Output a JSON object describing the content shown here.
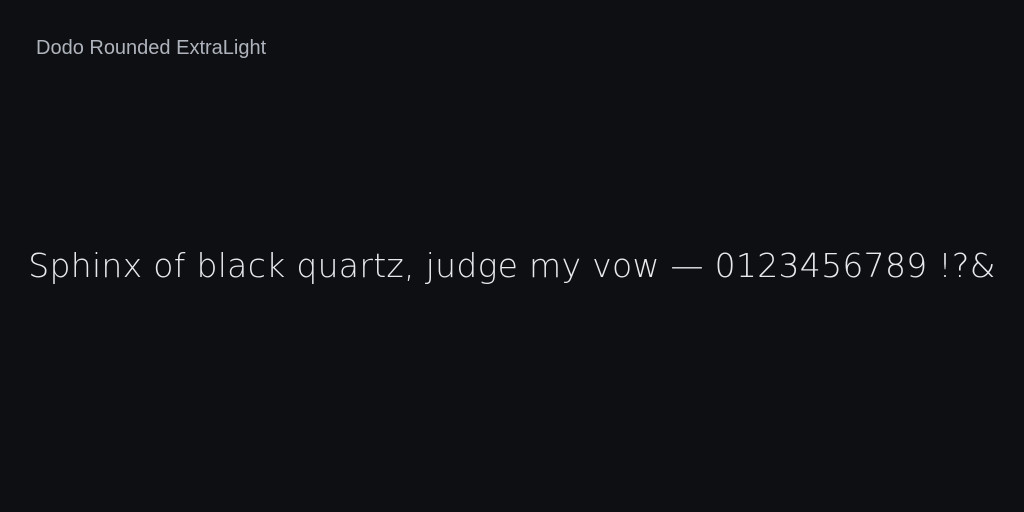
{
  "font": {
    "name": "Dodo Rounded ExtraLight"
  },
  "specimen": {
    "text": "Sphinx of black quartz, judge my vow — 0123456789 !?&"
  },
  "colors": {
    "background": "#0e0f12",
    "label": "#aeb3bc",
    "specimen_text": "#e7e9ee"
  }
}
